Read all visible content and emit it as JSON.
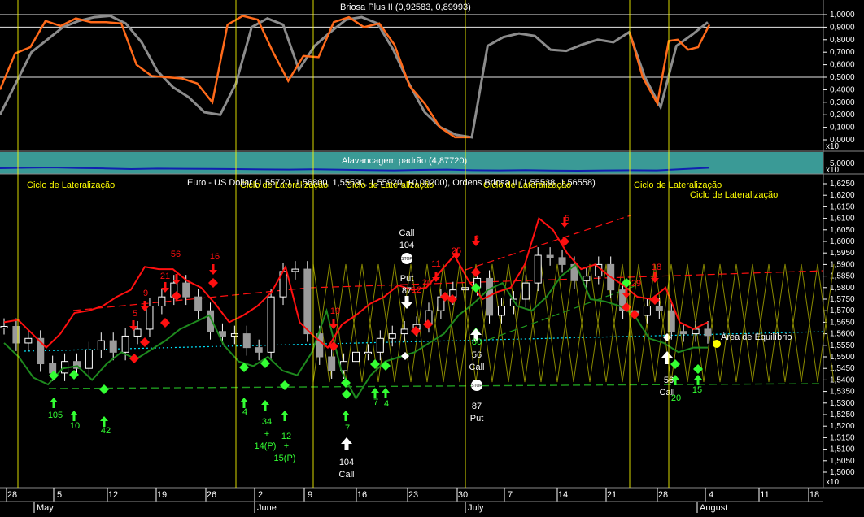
{
  "colors": {
    "background": "#000000",
    "teal_band": "#3a9a96",
    "orange": "#ff6a1a",
    "gray": "#8c8c8c",
    "red": "#ff1010",
    "green": "#1e8a1e",
    "bright_green": "#33ff33",
    "yellow": "#ffff00",
    "cyan": "#00e5ff",
    "white": "#ffffff",
    "blue": "#1020b0"
  },
  "top_panel": {
    "title": "Briosa Plus II (0,92583, 0,89993)",
    "scale_tag": "x10",
    "y_ticks": [
      "1,0000",
      "0,9000",
      "0,8000",
      "0,7000",
      "0,6000",
      "0,5000",
      "0,4000",
      "0,3000",
      "0,2000",
      "0,1000",
      "0,0000"
    ]
  },
  "mid_panel": {
    "title": "Alavancagem padrão (4,87720)",
    "scale_tag": "x10",
    "y_tick": "5,0000"
  },
  "main_panel": {
    "title": "Euro - US Dollar (1,55720, 1,56800, 1,55590, 1,55920, +0,00200), Ordens Briosa II (1,55538, 1,56558)",
    "scale_tag": "x10",
    "cycle_labels": [
      "Ciclo de Lateralização",
      "Ciclo de Lateralização",
      "Ciclo de Lateralização",
      "Ciclo de Lateralização",
      "Ciclo de Lateralização",
      "Ciclo de Lateralização"
    ],
    "equilibrium_label": "Área de Equilíbrio",
    "y_ticks": [
      "1,6250",
      "1,6200",
      "1,6150",
      "1,6100",
      "1,6050",
      "1,6000",
      "1,5950",
      "1,5900",
      "1,5850",
      "1,5800",
      "1,5750",
      "1,5700",
      "1,5650",
      "1,5600",
      "1,5550",
      "1,5500",
      "1,5450",
      "1,5400",
      "1,5350",
      "1,5300",
      "1,5250",
      "1,5200",
      "1,5150",
      "1,5100",
      "1,5050",
      "1,5000"
    ]
  },
  "x_axis": {
    "days": [
      "28",
      "5",
      "12",
      "19",
      "26",
      "2",
      "9",
      "16",
      "23",
      "30",
      "7",
      "14",
      "21",
      "28",
      "4",
      "11",
      "18"
    ],
    "months": [
      "May",
      "June",
      "July",
      "August"
    ]
  },
  "annotations": {
    "red_numbers": [
      "56",
      "16",
      "21",
      "9",
      "5",
      "19",
      "11",
      "25",
      "20",
      "12",
      "2",
      "5",
      "18",
      "29"
    ],
    "green_numbers": [
      "105",
      "10",
      "42",
      "4",
      "34",
      "12",
      "7",
      "7",
      "4",
      "80",
      "20",
      "15"
    ],
    "green_subs": [
      "+",
      "14(P)",
      "+",
      "15(P)"
    ],
    "white_labels": [
      "Call",
      "104",
      "Put",
      "87",
      "56",
      "Call",
      "87",
      "Put",
      "104",
      "Call",
      "56",
      "Call"
    ]
  },
  "chart_data": [
    {
      "type": "line",
      "title": "Briosa Plus II (0,92583, 0,89993)",
      "ylim": [
        0,
        1
      ],
      "series": [
        {
          "name": "orange",
          "values": [
            0.4,
            0.69,
            0.74,
            0.95,
            0.91,
            0.97,
            0.94,
            0.94,
            0.93,
            0.6,
            0.51,
            0.5,
            0.49,
            0.45,
            0.3,
            0.92,
            0.99,
            0.96,
            0.7,
            0.47,
            0.67,
            0.66,
            0.94,
            0.98,
            0.9,
            0.93,
            0.76,
            0.43,
            0.29,
            0.1,
            0.02,
            0.02
          ]
        },
        {
          "name": "gray",
          "values": [
            0.2,
            0.45,
            0.7,
            0.8,
            0.9,
            0.95,
            0.98,
            0.99,
            0.93,
            0.78,
            0.55,
            0.42,
            0.34,
            0.22,
            0.2,
            0.45,
            0.9,
            0.97,
            0.92,
            0.56,
            0.75,
            0.86,
            0.96,
            0.98,
            0.93,
            0.72,
            0.45,
            0.22,
            0.1,
            0.04,
            0.02,
            0.75,
            0.82,
            0.85,
            0.83,
            0.72,
            0.71,
            0.76,
            0.8,
            0.78,
            0.86,
            0.5,
            0.26,
            0.75,
            0.84,
            0.94
          ]
        }
      ]
    },
    {
      "type": "line",
      "title": "Alavancagem padrão (4,87720)",
      "series": [
        {
          "name": "Alavancagem padrão",
          "values": [
            4.85,
            4.88,
            4.9,
            4.86,
            4.84,
            4.8,
            4.83,
            4.82,
            4.81,
            4.8,
            4.78,
            4.77,
            4.79,
            4.76,
            4.74,
            4.72,
            4.75,
            4.77,
            4.73,
            4.72,
            4.74,
            4.71,
            4.7,
            4.72,
            4.73,
            4.72,
            4.8,
            4.88
          ]
        }
      ]
    },
    {
      "type": "line",
      "title": "Euro - US Dollar (1,55720, 1,56800, 1,55590, 1,55920, +0,00200), Ordens Briosa II (1,55538, 1,56558)",
      "ylim": [
        1.5,
        1.625
      ],
      "series": [
        {
          "name": "Euro - US Dollar",
          "values": [
            1.5632,
            1.556,
            1.558,
            1.547,
            1.543,
            1.548,
            1.545,
            1.553,
            1.557,
            1.552,
            1.559,
            1.562,
            1.572,
            1.576,
            1.582,
            1.576,
            1.57,
            1.561,
            1.559,
            1.56,
            1.554,
            1.552,
            1.576,
            1.587,
            1.588,
            1.56,
            1.55,
            1.544,
            1.548,
            1.552,
            1.552,
            1.558,
            1.56,
            1.562,
            1.564,
            1.57,
            1.576,
            1.579,
            1.58,
            1.584,
            1.568,
            1.572,
            1.575,
            1.582,
            1.594,
            1.593,
            1.59,
            1.583,
            1.585,
            1.59,
            1.579,
            1.57,
            1.568,
            1.572,
            1.57,
            1.561,
            1.56,
            1.562,
            1.5592
          ]
        },
        {
          "name": "red",
          "values": [
            1.565,
            1.566,
            1.56,
            1.554,
            1.56,
            1.569,
            1.57,
            1.572,
            1.576,
            1.579,
            1.589,
            1.588,
            1.588,
            1.583,
            1.58,
            1.573,
            1.565,
            1.568,
            1.572,
            1.578,
            1.589,
            1.565,
            1.559,
            1.554,
            1.564,
            1.568,
            1.573,
            1.576,
            1.581,
            1.579,
            1.58,
            1.587,
            1.594,
            1.583,
            1.575,
            1.578,
            1.58,
            1.59,
            1.61,
            1.605,
            1.595,
            1.588,
            1.59,
            1.585,
            1.581,
            1.576,
            1.575,
            1.58,
            1.565,
            1.562,
            1.565
          ]
        },
        {
          "name": "green",
          "values": [
            1.556,
            1.55,
            1.541,
            1.538,
            1.545,
            1.546,
            1.54,
            1.547,
            1.552,
            1.549,
            1.553,
            1.557,
            1.562,
            1.565,
            1.568,
            1.555,
            1.548,
            1.546,
            1.55,
            1.544,
            1.542,
            1.552,
            1.57,
            1.544,
            1.532,
            1.542,
            1.548,
            1.55,
            1.552,
            1.556,
            1.56,
            1.568,
            1.573,
            1.579,
            1.582,
            1.572,
            1.57,
            1.576,
            1.585,
            1.59,
            1.575,
            1.574,
            1.572,
            1.568,
            1.558,
            1.556,
            1.552,
            1.554,
            1.554
          ]
        }
      ]
    }
  ]
}
